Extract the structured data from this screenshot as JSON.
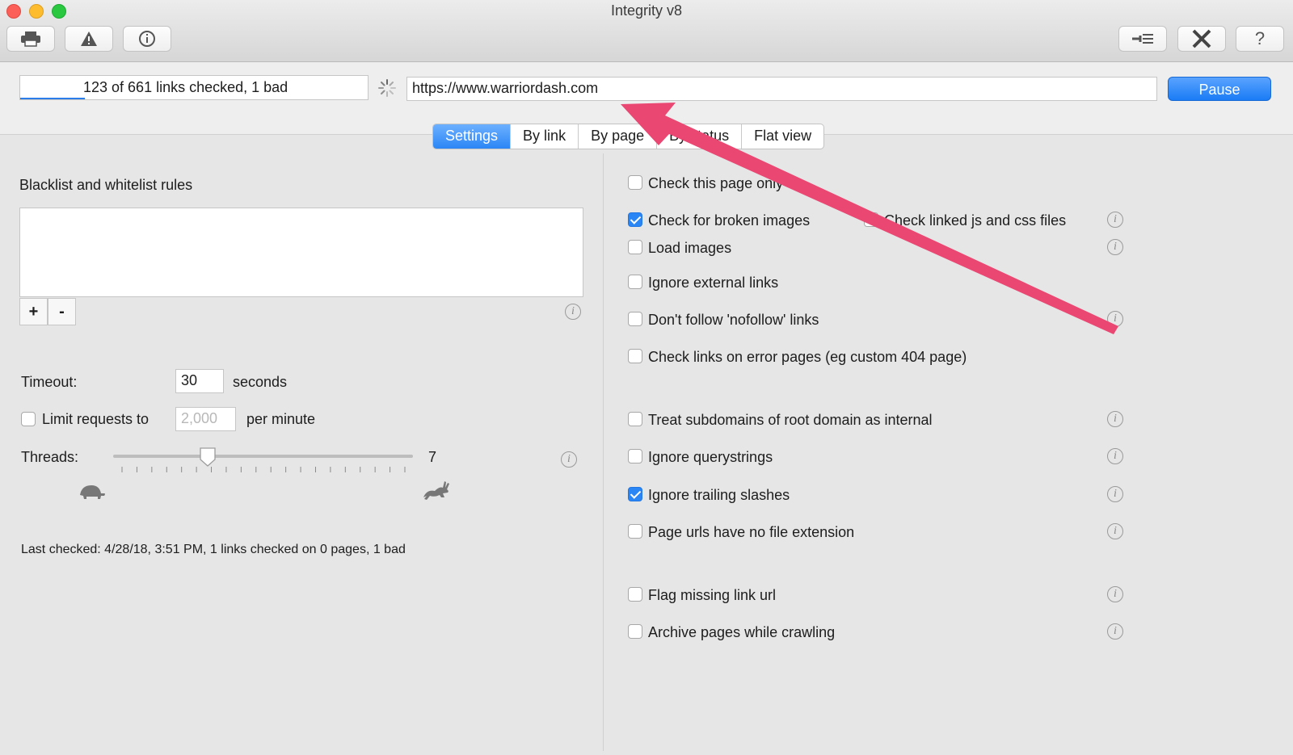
{
  "window": {
    "title": "Integrity v8"
  },
  "toolbar": {
    "left": [
      {
        "name": "print-button",
        "icon": "printer-icon"
      },
      {
        "name": "warning-button",
        "icon": "warning-icon"
      },
      {
        "name": "info-button",
        "icon": "info-icon"
      }
    ],
    "right": [
      {
        "name": "filter-settings-button",
        "icon": "wrench-list-icon"
      },
      {
        "name": "tools-button",
        "icon": "tools-icon"
      },
      {
        "name": "help-button",
        "icon": "question-icon",
        "label": "?"
      }
    ]
  },
  "scan": {
    "status": "123 of 661 links checked, 1 bad",
    "progress": 0.186,
    "url": "https://www.warriordash.com",
    "pause_label": "Pause"
  },
  "tabs": [
    {
      "label": "Settings",
      "active": true
    },
    {
      "label": "By link",
      "active": false
    },
    {
      "label": "By page",
      "active": false
    },
    {
      "label": "By status",
      "active": false
    },
    {
      "label": "Flat view",
      "active": false
    }
  ],
  "left": {
    "rules_label": "Blacklist and whitelist rules",
    "add_label": "+",
    "remove_label": "-",
    "timeout_label": "Timeout:",
    "timeout_value": "30",
    "timeout_unit": "seconds",
    "limit_label": "Limit requests to",
    "limit_checked": false,
    "limit_value": "2,000",
    "limit_unit": "per minute",
    "threads_label": "Threads:",
    "threads_value": "7",
    "threads_min": 1,
    "threads_max": 20,
    "last_checked": "Last checked: 4/28/18, 3:51 PM, 1 links checked on 0 pages, 1 bad"
  },
  "options": [
    {
      "label": "Check this page only",
      "checked": false
    },
    {
      "label": "Check for broken images",
      "checked": true
    },
    {
      "label": "Check linked js and css files",
      "checked": false
    },
    {
      "label": "Load images",
      "checked": false
    },
    {
      "label": "Ignore external links",
      "checked": false
    },
    {
      "label": "Don't follow 'nofollow' links",
      "checked": false
    },
    {
      "label": "Check links on error pages (eg custom 404 page)",
      "checked": false
    },
    {
      "label": "Treat subdomains of root domain as internal",
      "checked": false
    },
    {
      "label": "Ignore querystrings",
      "checked": false
    },
    {
      "label": "Ignore trailing slashes",
      "checked": true
    },
    {
      "label": "Page urls have no file extension",
      "checked": false
    },
    {
      "label": "Flag missing link url",
      "checked": false
    },
    {
      "label": "Archive pages while crawling",
      "checked": false
    }
  ],
  "colors": {
    "accent": "#2b86f5",
    "arrow": "#ea4773"
  }
}
